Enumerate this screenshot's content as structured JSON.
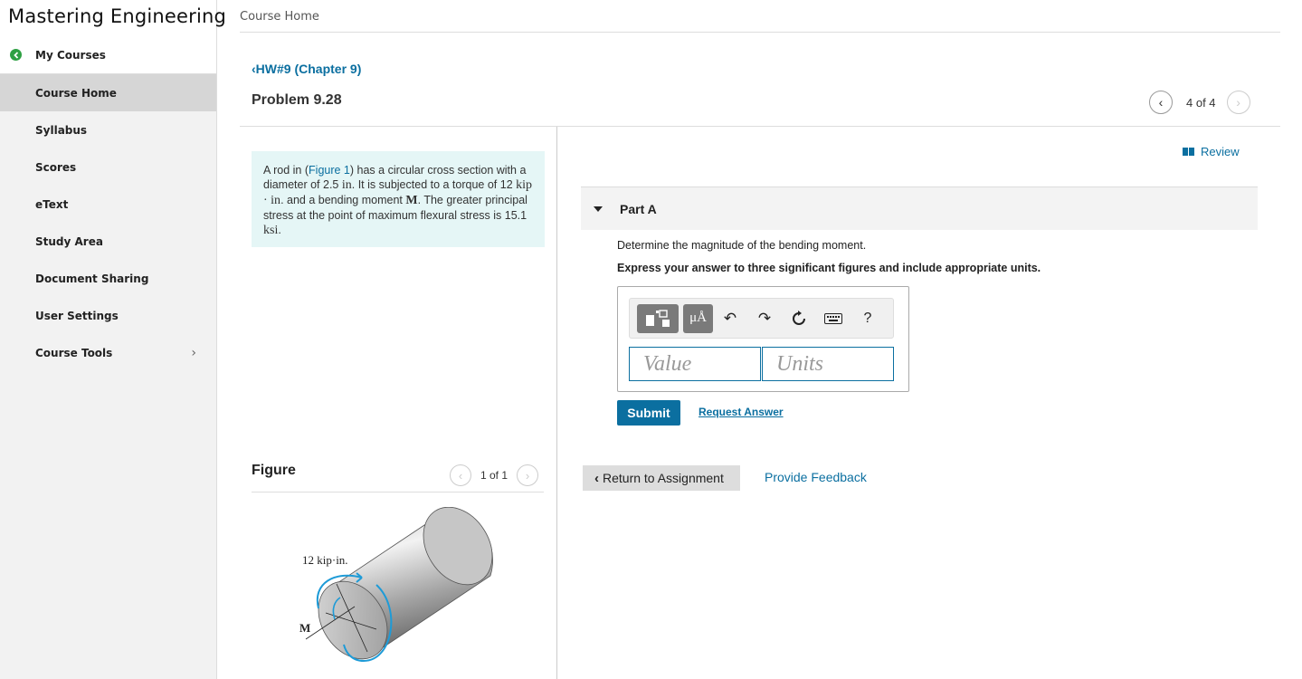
{
  "app": {
    "brand": "Mastering Engineering"
  },
  "sidebar": {
    "my_courses": "My Courses",
    "items": [
      {
        "label": "Course Home"
      },
      {
        "label": "Syllabus"
      },
      {
        "label": "Scores"
      },
      {
        "label": "eText"
      },
      {
        "label": "Study Area"
      },
      {
        "label": "Document Sharing"
      },
      {
        "label": "User Settings"
      },
      {
        "label": "Course Tools"
      }
    ]
  },
  "header": {
    "title": "Course Home"
  },
  "assignment": {
    "breadcrumb": "HW#9 (Chapter 9)",
    "problem_title": "Problem 9.28",
    "pager": "4 of 4"
  },
  "statement": {
    "p1": "A rod in (",
    "figure_link": "Figure 1",
    "p2": ") has a circular cross section with a diameter of 2.5",
    "m1": "in",
    "p3": ". It is subjected to a torque of 12",
    "m2": "kip · in",
    "p4": ". and a bending moment",
    "m3": "M",
    "p5": ". The greater principal stress at the point of maximum flexural stress is 15.1",
    "m4": "ksi",
    "p6": "."
  },
  "figure": {
    "title": "Figure",
    "pager": "1 of 1",
    "torque_label": "12 kip·in.",
    "moment_label": "M"
  },
  "review": "Review",
  "part_a": {
    "label": "Part A",
    "question": "Determine the magnitude of the bending moment.",
    "instruction": "Express your answer to three significant figures and include appropriate units.",
    "toolbar": {
      "units_button": "μÅ",
      "help": "?"
    },
    "value_placeholder": "Value",
    "units_placeholder": "Units",
    "submit": "Submit",
    "request_answer": "Request Answer"
  },
  "footer": {
    "return": "Return to Assignment",
    "feedback": "Provide Feedback"
  }
}
